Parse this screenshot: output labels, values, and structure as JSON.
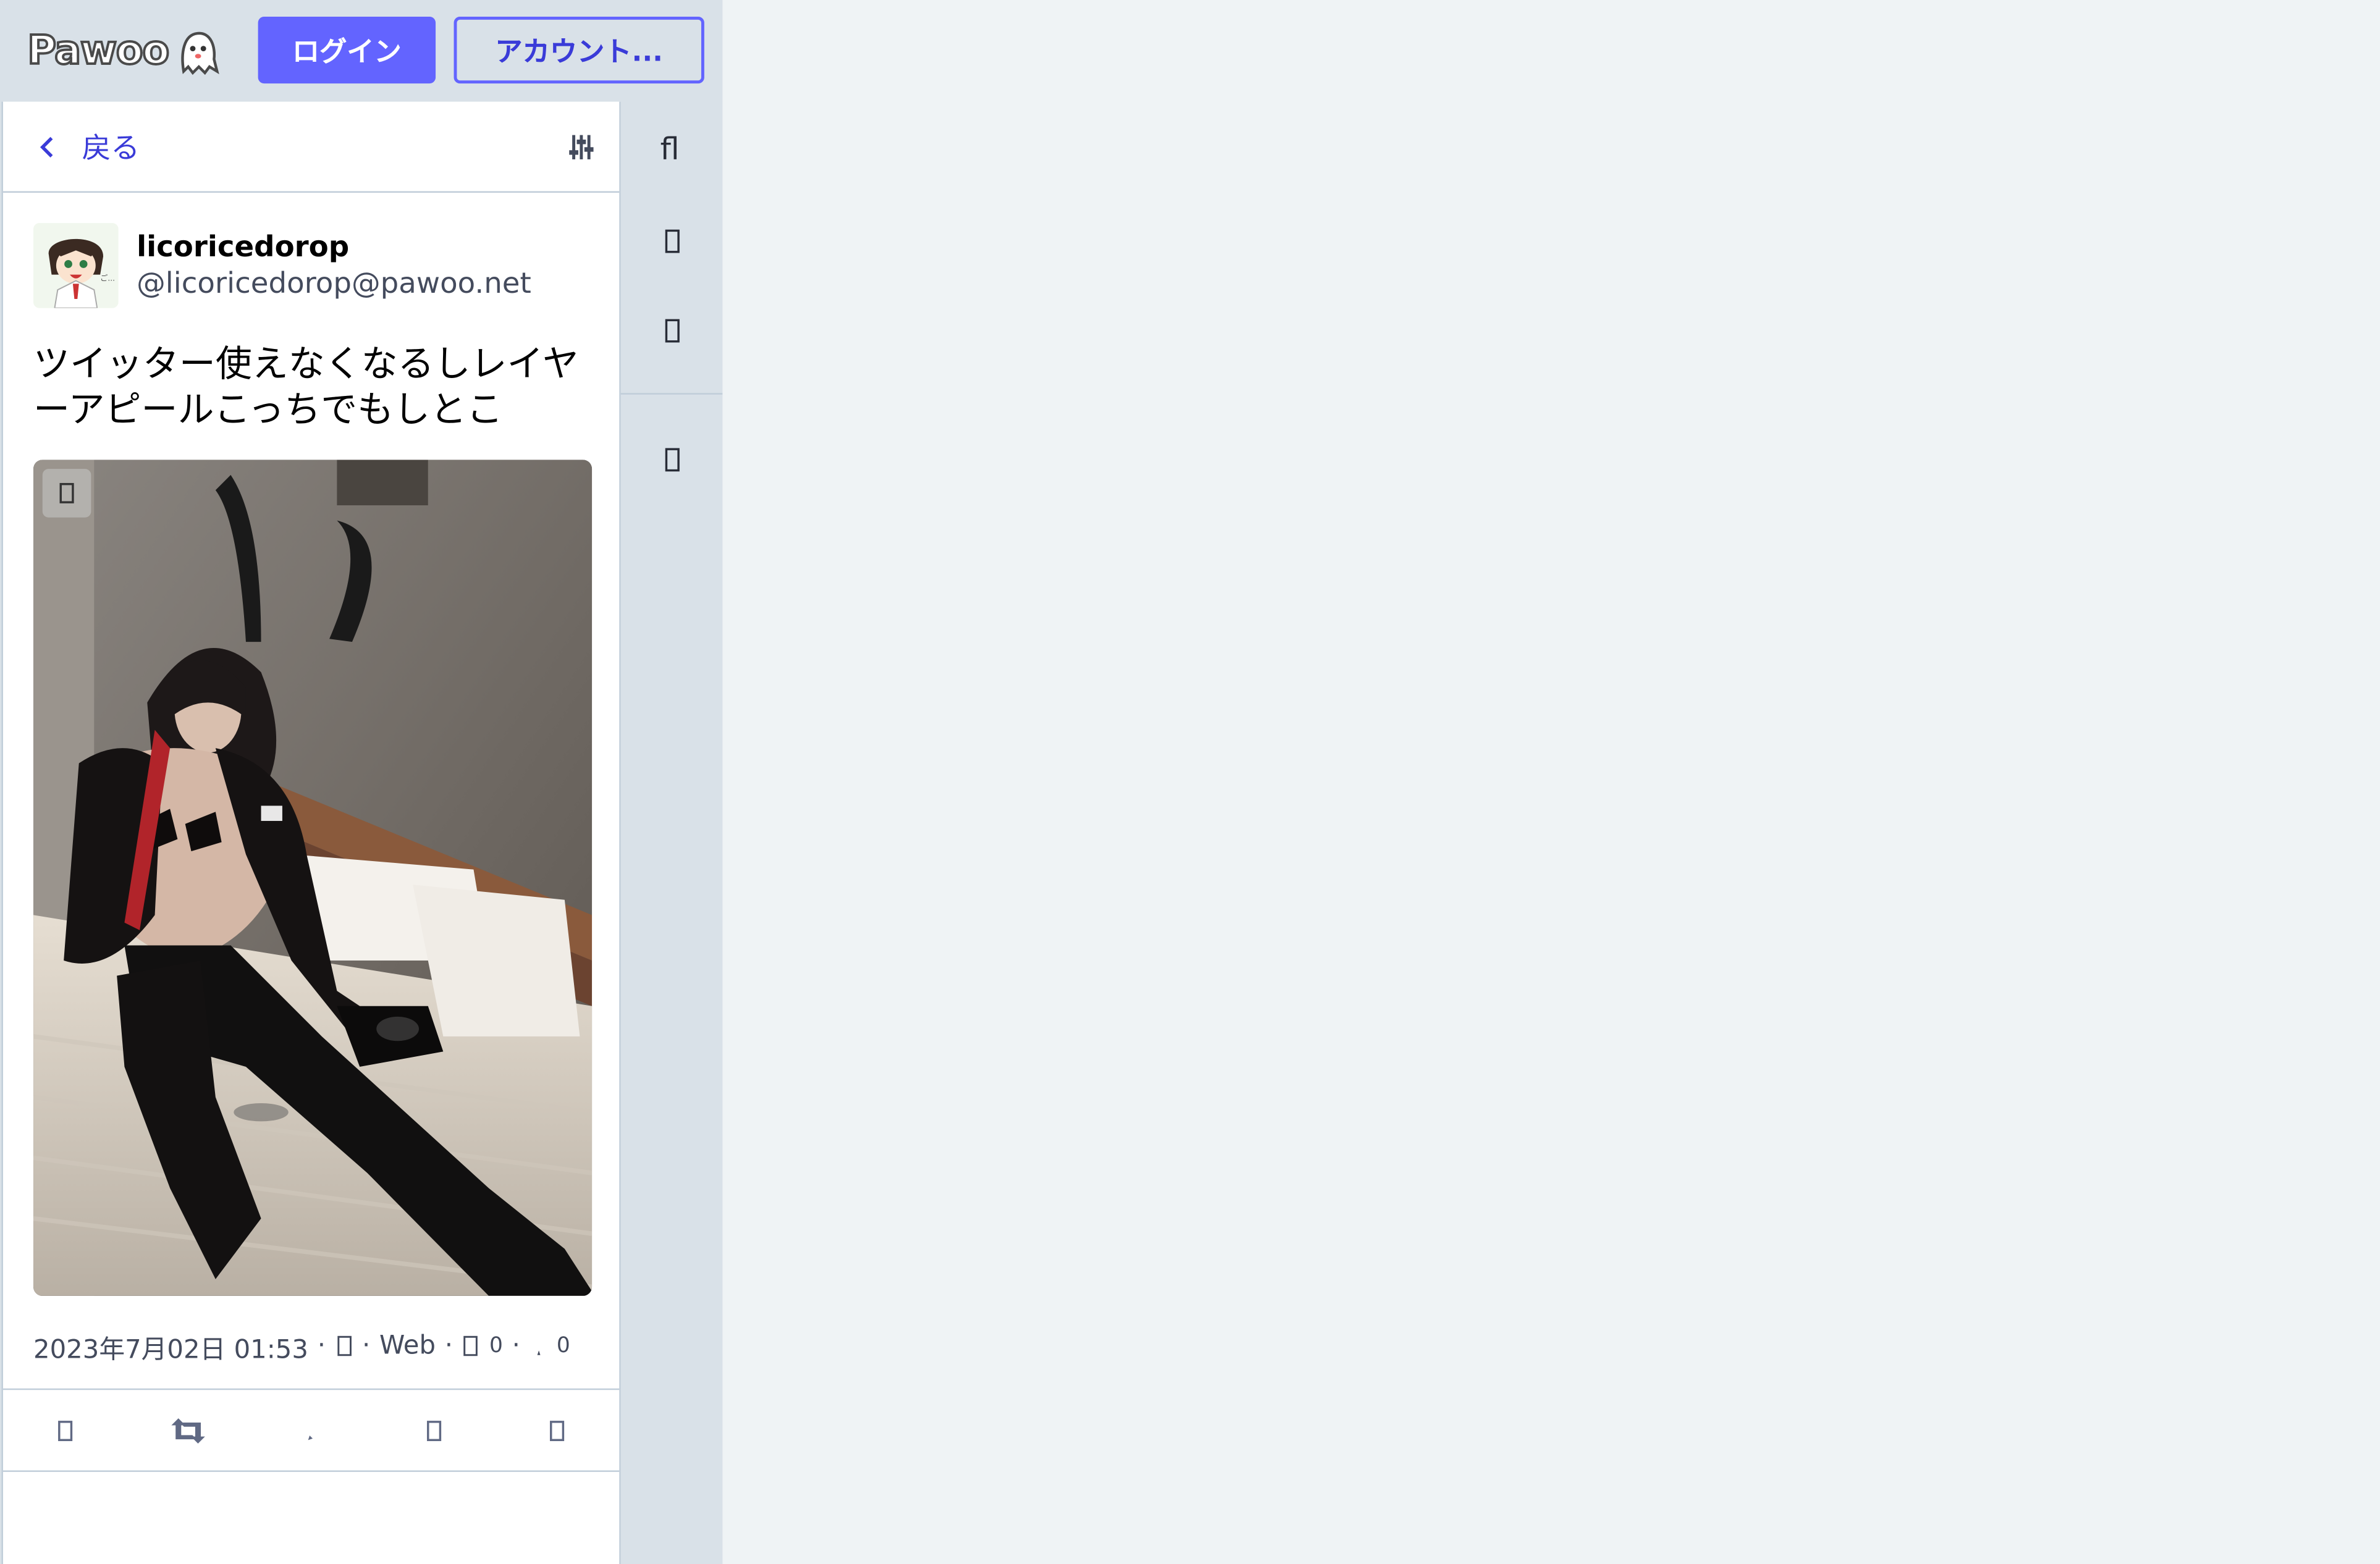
{
  "header": {
    "logo_text": "Pawoo",
    "login_label": "ログイン",
    "account_label": "アカウント..."
  },
  "column": {
    "back_label": "戻る"
  },
  "status": {
    "display_name": "licoricedorop",
    "handle": "@licoricedorop@pawoo.net",
    "text": "ツイッター使えなくなるしレイヤーアピールこっちでもしとこ",
    "timestamp": "2023年7月02日 01:53",
    "sep1": "·",
    "sep2": "·",
    "sep3": "·",
    "app": "Web",
    "reblogs": "0",
    "favourites": "0"
  },
  "nav": {
    "items": [
      "fl-icon",
      "bell-icon",
      "globe-icon",
      "gear-icon"
    ]
  },
  "colors": {
    "accent": "#6364ff",
    "sidebar_bg": "#d9e1e8",
    "page_bg": "#eff3f5"
  }
}
